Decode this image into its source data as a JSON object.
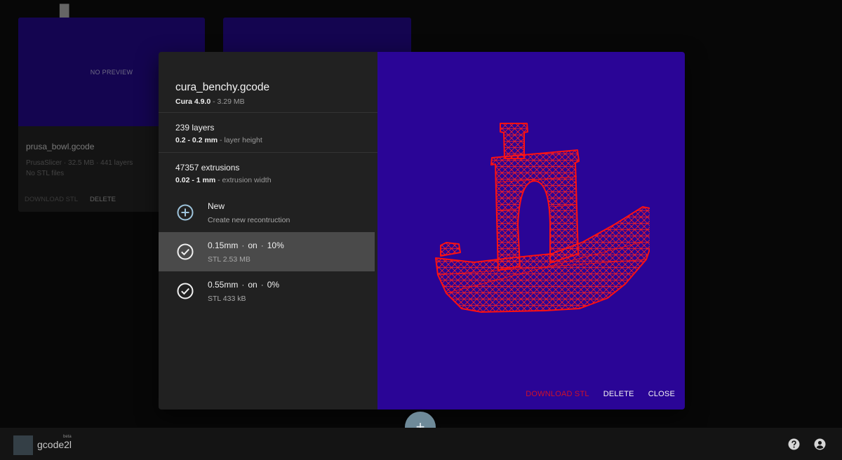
{
  "background_cards": [
    {
      "thumb_text": "NO PREVIEW",
      "name": "prusa_bowl.gcode",
      "meta_line": "PrusaSlicer · 32.5 MB · 441 layers",
      "stl_line": "No STL files",
      "download_label": "DOWNLOAD STL",
      "delete_label": "DELETE"
    }
  ],
  "dialog": {
    "title": "cura_benchy.gcode",
    "slicer": "Cura 4.9.0",
    "size": " - 3.29 MB",
    "layers": {
      "main": "239 layers",
      "range": "0.2 - 0.2 mm",
      "suffix": " - layer height"
    },
    "extrusions": {
      "main": "47357 extrusions",
      "range": "0.02 - 1 mm",
      "suffix": " - extrusion width"
    },
    "new_item": {
      "label": "New",
      "sub": "Create new recontruction"
    },
    "reconstructions": [
      {
        "res": "0.15mm",
        "mode": "on",
        "pct": "10%",
        "sub": "STL 2.53 MB",
        "selected": true
      },
      {
        "res": "0.55mm",
        "mode": "on",
        "pct": "0%",
        "sub": "STL 433 kB",
        "selected": false
      }
    ],
    "actions": {
      "download": "DOWNLOAD STL",
      "delete": "DELETE",
      "close": "CLOSE"
    },
    "viewer_bg": "#2a0596",
    "mesh_color": "#ff1010"
  },
  "fab_icon": "+",
  "bottom_bar": {
    "app_name": "gcode2l",
    "badge": "beta"
  },
  "icons": [
    "plus-circle-icon",
    "check-circle-icon",
    "grid-icon",
    "info-icon",
    "help-icon",
    "account-icon",
    "plus-icon"
  ]
}
